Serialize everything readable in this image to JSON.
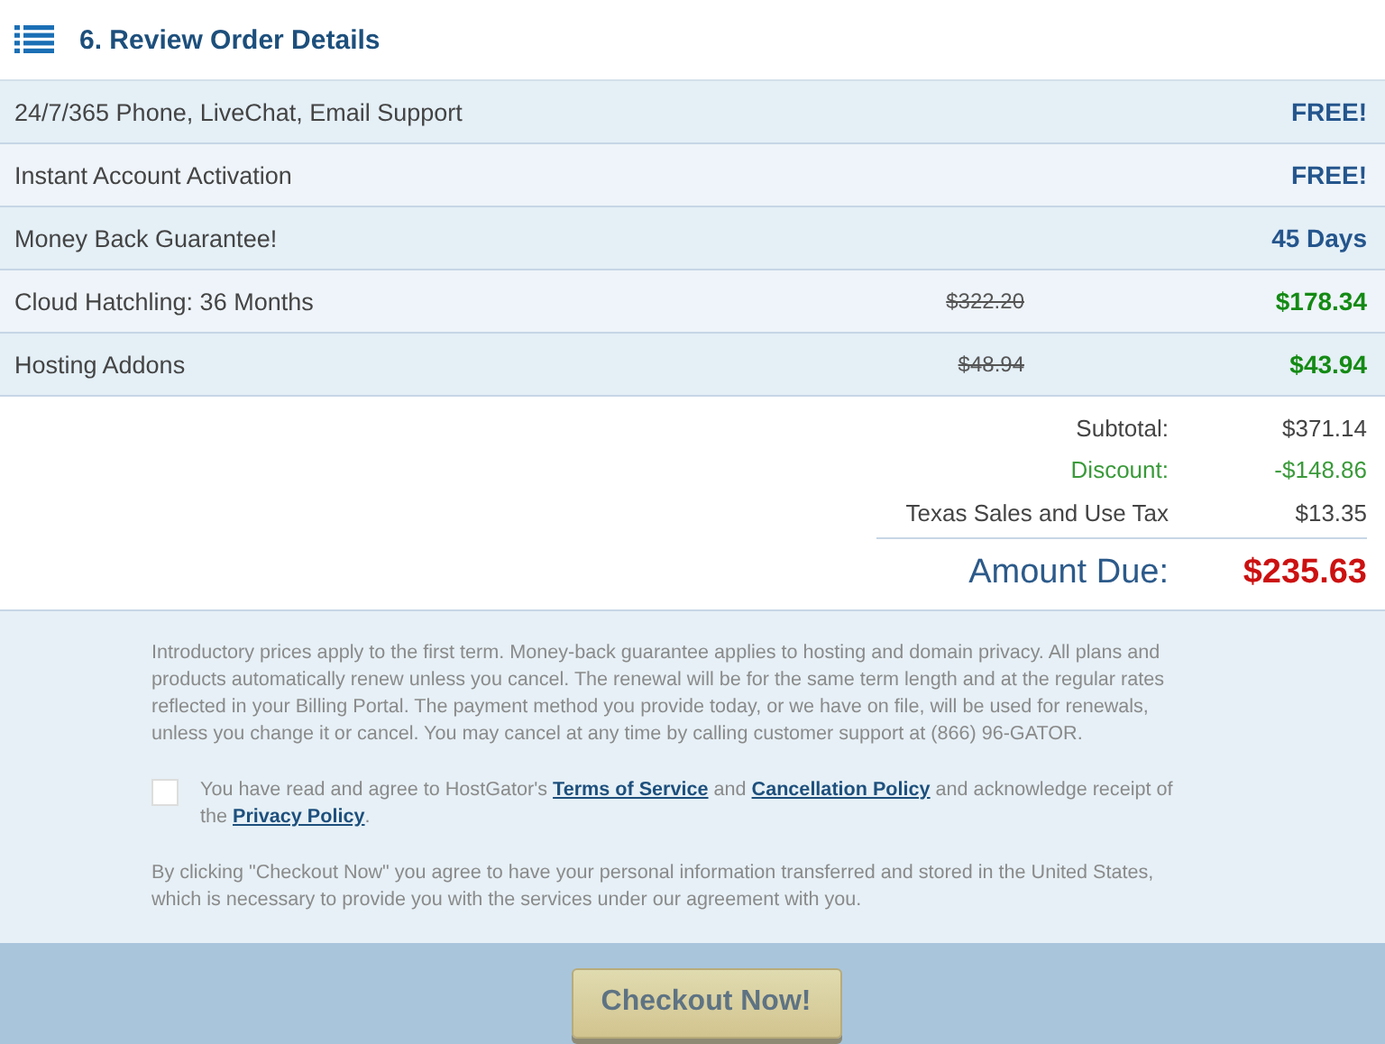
{
  "header": {
    "title": "6. Review Order Details"
  },
  "items": [
    {
      "label": "24/7/365 Phone, LiveChat, Email Support",
      "kind": "perk",
      "value": "FREE!"
    },
    {
      "label": "Instant Account Activation",
      "kind": "perk",
      "value": "FREE!"
    },
    {
      "label": "Money Back Guarantee!",
      "kind": "perk",
      "value": "45 Days"
    },
    {
      "label": "Cloud Hatchling: 36 Months",
      "kind": "product",
      "original_price": "$322.20",
      "value": "$178.34"
    },
    {
      "label": "Hosting Addons",
      "kind": "product",
      "original_price": "$48.94",
      "value": "$43.94"
    }
  ],
  "summary": [
    {
      "kind": "line",
      "label": "Subtotal:",
      "value": "$371.14"
    },
    {
      "kind": "discount",
      "label": "Discount:",
      "value": "-$148.86"
    },
    {
      "kind": "line",
      "label": "Texas Sales and Use Tax",
      "value": "$13.35"
    },
    {
      "kind": "total",
      "label": "Amount Due:",
      "value": "$235.63"
    }
  ],
  "disclaimer": "Introductory prices apply to the first term. Money-back guarantee applies to hosting and domain privacy. All plans and products automatically renew unless you cancel. The renewal will be for the same term length and at the regular rates reflected in your Billing Portal. The payment method you provide today, or we have on file, will be used for renewals, unless you change it or cancel. You may cancel at any time by calling customer support at (866) 96-GATOR.",
  "agreement": {
    "checked": false,
    "parts": [
      {
        "kind": "text",
        "text": "You have read and agree to HostGator's"
      },
      {
        "kind": "link",
        "text": "Terms of Service"
      },
      {
        "kind": "text",
        "text": "and"
      },
      {
        "kind": "link",
        "text": "Cancellation Policy"
      },
      {
        "kind": "text",
        "text": "and acknowledge receipt of the"
      },
      {
        "kind": "link",
        "text": "Privacy Policy"
      },
      {
        "kind": "text",
        "text": "."
      }
    ]
  },
  "consent": "By clicking \"Checkout Now\" you agree to have your personal information transferred and stored in the United States, which is necessary to provide you with the services under our agreement with you.",
  "checkout_button": "Checkout Now!"
}
